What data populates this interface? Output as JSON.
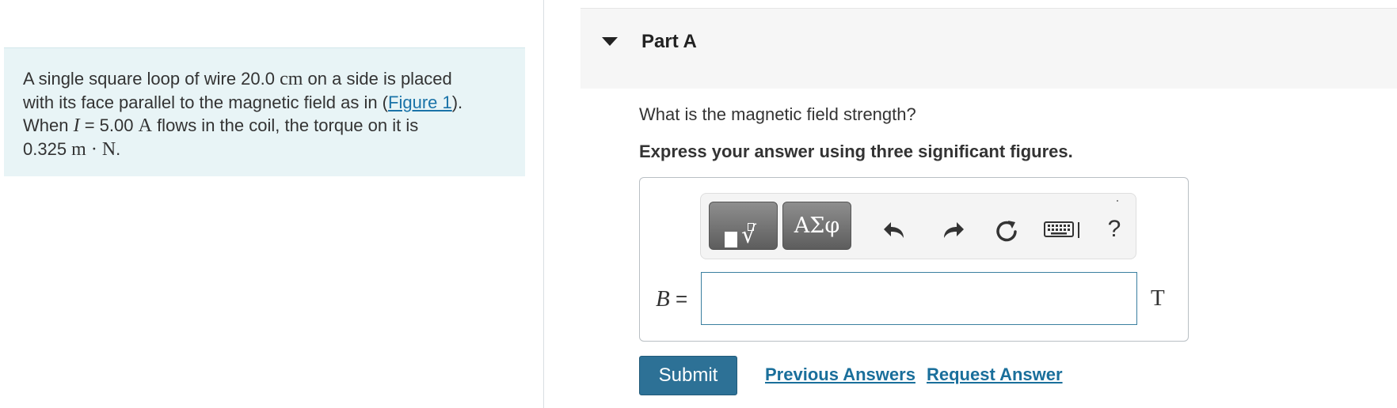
{
  "problem": {
    "line1_text": "A single square loop of wire 20.0",
    "line1_unit": "cm",
    "line1_rest": " on a side is placed",
    "line2_text": "with its face parallel to the magnetic field as in (",
    "figure_link": "Figure 1",
    "line2_end": ").",
    "line3_when": "When ",
    "line3_var": "I",
    "line3_value": " = 5.00 ",
    "line3_unit": "A",
    "line3_rest": " flows in the coil, the torque on it is",
    "line4_value": "0.325 ",
    "line4_unit": "m · N",
    "line4_end": "."
  },
  "part": {
    "title": "Part A",
    "question": "What is the magnetic field strength?",
    "instruction": "Express your answer using three significant figures."
  },
  "toolbar": {
    "templates_icon": "templates-icon",
    "greek_label": "ΑΣφ",
    "undo_icon": "undo-icon",
    "redo_icon": "redo-icon",
    "reset_icon": "reset-icon",
    "keyboard_icon": "keyboard-icon",
    "help_label": "?"
  },
  "answer": {
    "variable": "B",
    "equals": " =",
    "value": "",
    "unit": "T"
  },
  "actions": {
    "submit_label": "Submit",
    "previous_answers_label": "Previous Answers",
    "request_answer_label": "Request Answer"
  },
  "colors": {
    "problem_bg": "#e8f4f6",
    "accent": "#2d7196",
    "link": "#1a6f9b"
  }
}
